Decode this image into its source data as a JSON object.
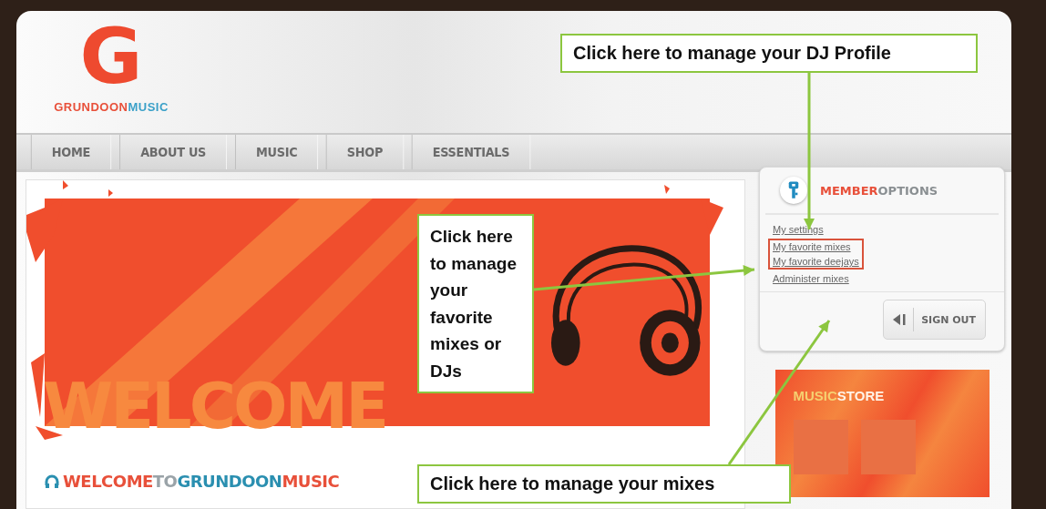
{
  "logo": {
    "mark": "G",
    "name_parts": [
      "GRUNDOON",
      "MUSIC"
    ]
  },
  "nav": [
    {
      "label": "HOME"
    },
    {
      "label": "ABOUT US"
    },
    {
      "label": "MUSIC"
    },
    {
      "label": "SHOP"
    },
    {
      "label": "ESSENTIALS"
    }
  ],
  "banner": {
    "headline": "WELCOME"
  },
  "welcome_heading": {
    "parts": [
      {
        "text": "WELCOME",
        "color": "#e8503a"
      },
      {
        "text": "TO",
        "color": "#9aa3a8"
      },
      {
        "text": "GRUNDOON",
        "color": "#2a8fb0"
      },
      {
        "text": "MUSIC",
        "color": "#e8503a"
      }
    ]
  },
  "member_options": {
    "title_parts": [
      "MEMBER",
      "OPTIONS"
    ],
    "links": [
      {
        "label": "My settings",
        "highlighted": false
      },
      {
        "label": "My favorite mixes",
        "highlighted": true
      },
      {
        "label": "My favorite deejays",
        "highlighted": true
      },
      {
        "label": "Administer mixes",
        "highlighted": false
      }
    ],
    "sign_out": "SIGN OUT"
  },
  "music_store": {
    "title_parts": [
      "MUSIC",
      "STORE"
    ]
  },
  "callouts": [
    {
      "text": "Click here to manage your DJ Profile"
    },
    {
      "text": "Click here to manage your favorite mixes or DJs"
    },
    {
      "text": "Click here to manage your mixes"
    }
  ]
}
